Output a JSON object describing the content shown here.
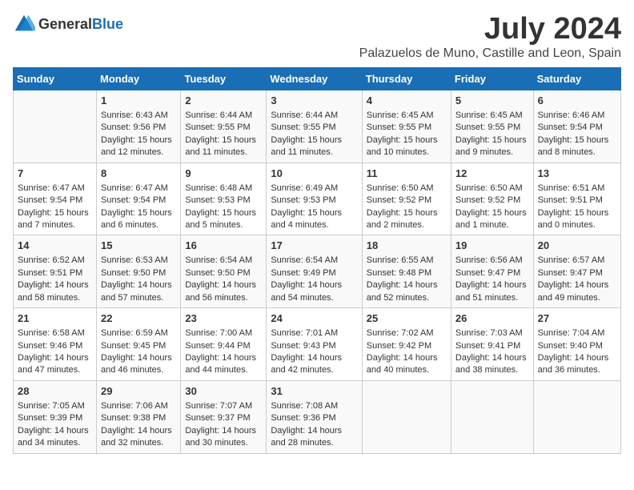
{
  "header": {
    "logo_general": "General",
    "logo_blue": "Blue",
    "title": "July 2024",
    "subtitle": "Palazuelos de Muno, Castille and Leon, Spain"
  },
  "calendar": {
    "days_of_week": [
      "Sunday",
      "Monday",
      "Tuesday",
      "Wednesday",
      "Thursday",
      "Friday",
      "Saturday"
    ],
    "weeks": [
      [
        {
          "day": "",
          "content": ""
        },
        {
          "day": "1",
          "content": "Sunrise: 6:43 AM\nSunset: 9:56 PM\nDaylight: 15 hours and 12 minutes."
        },
        {
          "day": "2",
          "content": "Sunrise: 6:44 AM\nSunset: 9:55 PM\nDaylight: 15 hours and 11 minutes."
        },
        {
          "day": "3",
          "content": "Sunrise: 6:44 AM\nSunset: 9:55 PM\nDaylight: 15 hours and 11 minutes."
        },
        {
          "day": "4",
          "content": "Sunrise: 6:45 AM\nSunset: 9:55 PM\nDaylight: 15 hours and 10 minutes."
        },
        {
          "day": "5",
          "content": "Sunrise: 6:45 AM\nSunset: 9:55 PM\nDaylight: 15 hours and 9 minutes."
        },
        {
          "day": "6",
          "content": "Sunrise: 6:46 AM\nSunset: 9:54 PM\nDaylight: 15 hours and 8 minutes."
        }
      ],
      [
        {
          "day": "7",
          "content": "Sunrise: 6:47 AM\nSunset: 9:54 PM\nDaylight: 15 hours and 7 minutes."
        },
        {
          "day": "8",
          "content": "Sunrise: 6:47 AM\nSunset: 9:54 PM\nDaylight: 15 hours and 6 minutes."
        },
        {
          "day": "9",
          "content": "Sunrise: 6:48 AM\nSunset: 9:53 PM\nDaylight: 15 hours and 5 minutes."
        },
        {
          "day": "10",
          "content": "Sunrise: 6:49 AM\nSunset: 9:53 PM\nDaylight: 15 hours and 4 minutes."
        },
        {
          "day": "11",
          "content": "Sunrise: 6:50 AM\nSunset: 9:52 PM\nDaylight: 15 hours and 2 minutes."
        },
        {
          "day": "12",
          "content": "Sunrise: 6:50 AM\nSunset: 9:52 PM\nDaylight: 15 hours and 1 minute."
        },
        {
          "day": "13",
          "content": "Sunrise: 6:51 AM\nSunset: 9:51 PM\nDaylight: 15 hours and 0 minutes."
        }
      ],
      [
        {
          "day": "14",
          "content": "Sunrise: 6:52 AM\nSunset: 9:51 PM\nDaylight: 14 hours and 58 minutes."
        },
        {
          "day": "15",
          "content": "Sunrise: 6:53 AM\nSunset: 9:50 PM\nDaylight: 14 hours and 57 minutes."
        },
        {
          "day": "16",
          "content": "Sunrise: 6:54 AM\nSunset: 9:50 PM\nDaylight: 14 hours and 56 minutes."
        },
        {
          "day": "17",
          "content": "Sunrise: 6:54 AM\nSunset: 9:49 PM\nDaylight: 14 hours and 54 minutes."
        },
        {
          "day": "18",
          "content": "Sunrise: 6:55 AM\nSunset: 9:48 PM\nDaylight: 14 hours and 52 minutes."
        },
        {
          "day": "19",
          "content": "Sunrise: 6:56 AM\nSunset: 9:47 PM\nDaylight: 14 hours and 51 minutes."
        },
        {
          "day": "20",
          "content": "Sunrise: 6:57 AM\nSunset: 9:47 PM\nDaylight: 14 hours and 49 minutes."
        }
      ],
      [
        {
          "day": "21",
          "content": "Sunrise: 6:58 AM\nSunset: 9:46 PM\nDaylight: 14 hours and 47 minutes."
        },
        {
          "day": "22",
          "content": "Sunrise: 6:59 AM\nSunset: 9:45 PM\nDaylight: 14 hours and 46 minutes."
        },
        {
          "day": "23",
          "content": "Sunrise: 7:00 AM\nSunset: 9:44 PM\nDaylight: 14 hours and 44 minutes."
        },
        {
          "day": "24",
          "content": "Sunrise: 7:01 AM\nSunset: 9:43 PM\nDaylight: 14 hours and 42 minutes."
        },
        {
          "day": "25",
          "content": "Sunrise: 7:02 AM\nSunset: 9:42 PM\nDaylight: 14 hours and 40 minutes."
        },
        {
          "day": "26",
          "content": "Sunrise: 7:03 AM\nSunset: 9:41 PM\nDaylight: 14 hours and 38 minutes."
        },
        {
          "day": "27",
          "content": "Sunrise: 7:04 AM\nSunset: 9:40 PM\nDaylight: 14 hours and 36 minutes."
        }
      ],
      [
        {
          "day": "28",
          "content": "Sunrise: 7:05 AM\nSunset: 9:39 PM\nDaylight: 14 hours and 34 minutes."
        },
        {
          "day": "29",
          "content": "Sunrise: 7:06 AM\nSunset: 9:38 PM\nDaylight: 14 hours and 32 minutes."
        },
        {
          "day": "30",
          "content": "Sunrise: 7:07 AM\nSunset: 9:37 PM\nDaylight: 14 hours and 30 minutes."
        },
        {
          "day": "31",
          "content": "Sunrise: 7:08 AM\nSunset: 9:36 PM\nDaylight: 14 hours and 28 minutes."
        },
        {
          "day": "",
          "content": ""
        },
        {
          "day": "",
          "content": ""
        },
        {
          "day": "",
          "content": ""
        }
      ]
    ]
  }
}
